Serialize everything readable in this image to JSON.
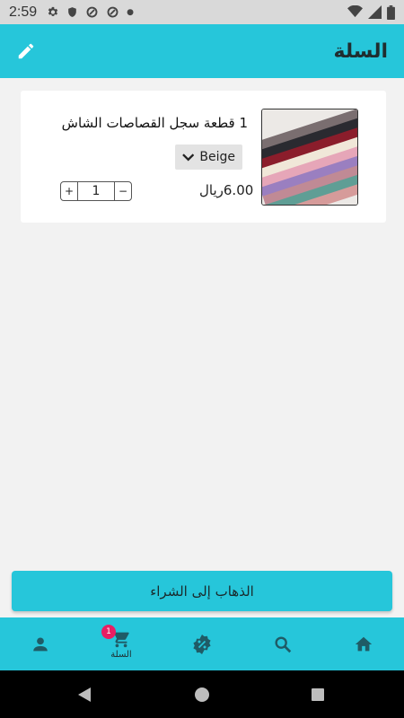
{
  "status_bar": {
    "time": "2:59"
  },
  "app_bar": {
    "title": "السلة"
  },
  "cart": {
    "items": [
      {
        "title": "1 قطعة سجل القصاصات الشاش",
        "variant": "Beige",
        "price": "6.00ريال",
        "quantity": "1",
        "increment_label": "+",
        "decrement_label": "−"
      }
    ]
  },
  "checkout": {
    "label": "الذهاب إلى الشراء"
  },
  "bottom_nav": {
    "cart_label": "السلة",
    "cart_badge": "1"
  },
  "colors": {
    "primary": "#26c6da",
    "badge": "#e91e63",
    "nav_icon": "#1f5b66"
  }
}
